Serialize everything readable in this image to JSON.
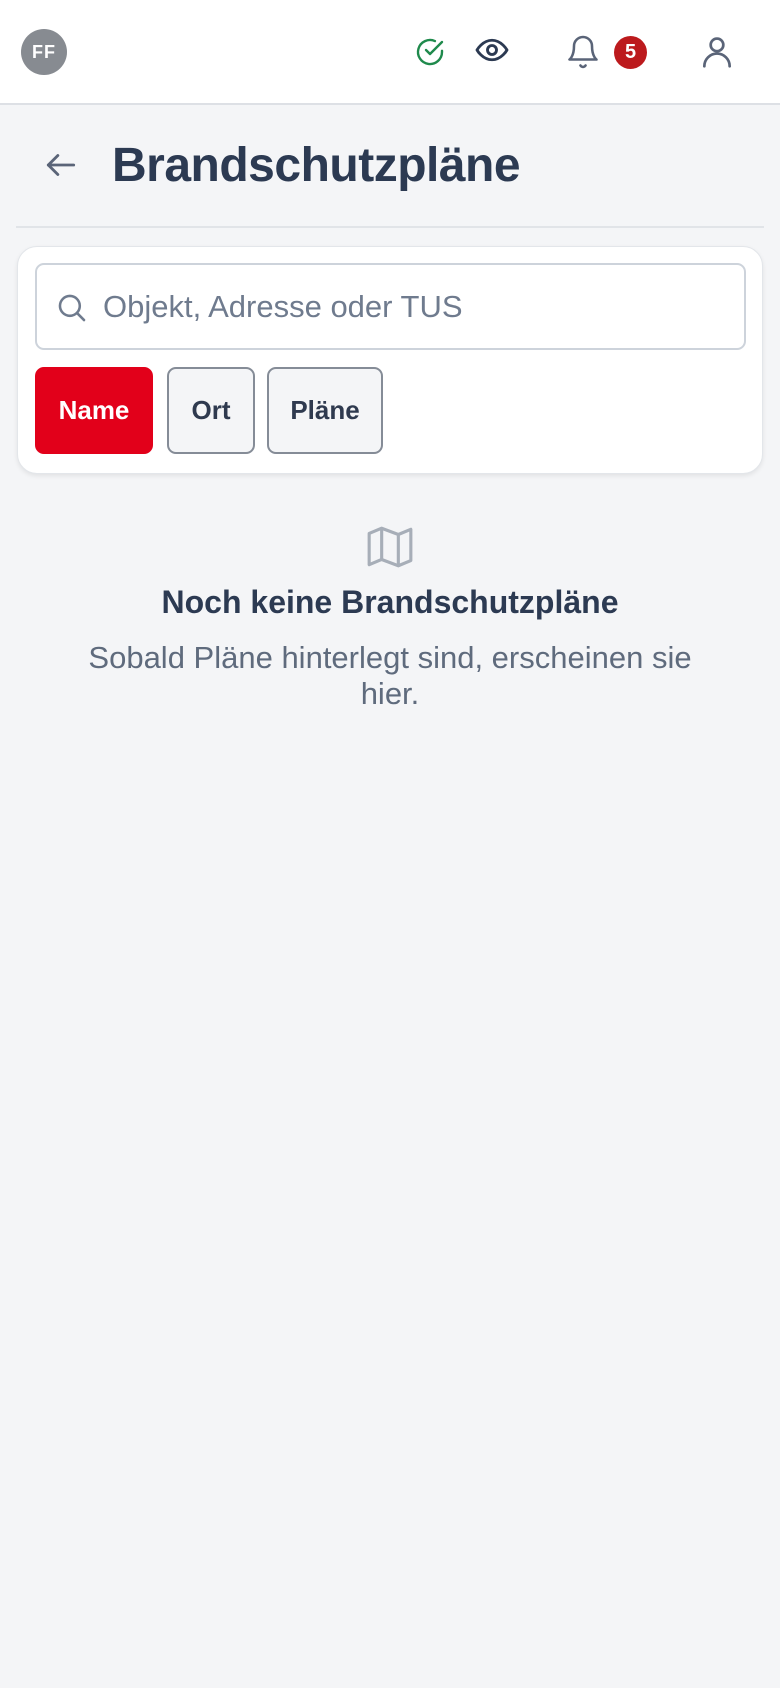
{
  "topbar": {
    "avatar_initials": "FF",
    "status_icon": "check-circle-icon",
    "status_color": "#1f8a4c",
    "eye_icon": "eye-icon",
    "bell_icon": "bell-icon",
    "notification_count": "5",
    "badge_color": "#bc1a1d",
    "user_icon": "user-icon"
  },
  "header": {
    "back_icon": "arrow-left-icon",
    "title": "Brandschutzpläne"
  },
  "search": {
    "icon": "search-icon",
    "placeholder": "Objekt, Adresse oder TUS",
    "value": ""
  },
  "sort_chips": [
    {
      "label": "Name",
      "active": true
    },
    {
      "label": "Ort",
      "active": false
    },
    {
      "label": "Pläne",
      "active": false
    }
  ],
  "accent_color": "#e2001a",
  "empty_state": {
    "icon": "map-icon",
    "title": "Noch keine Brandschutzpläne",
    "text": "Sobald Pläne hinterlegt sind, erscheinen sie hier."
  }
}
